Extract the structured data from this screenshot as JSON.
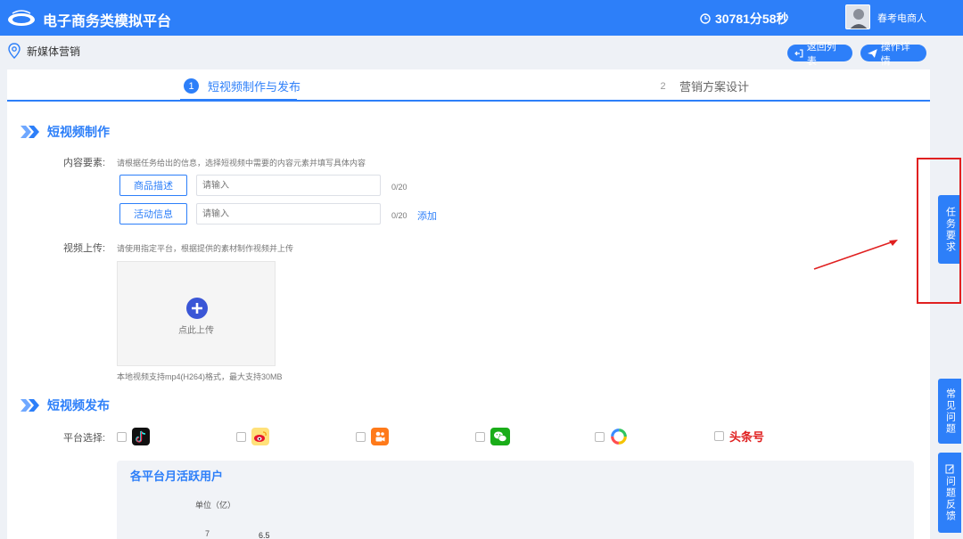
{
  "header": {
    "app_title": "电子商务类模拟平台",
    "timer": "30781分58秒",
    "username": "春考电商人"
  },
  "breadcrumb": {
    "label": "新媒体营销"
  },
  "actions": {
    "back_label": "返回列表",
    "detail_label": "操作详情"
  },
  "steps": [
    {
      "num": "1",
      "label": "短视频制作与发布",
      "active": true
    },
    {
      "num": "2",
      "label": "营销方案设计",
      "active": false
    }
  ],
  "production": {
    "title": "短视频制作",
    "content_label": "内容要素:",
    "content_hint": "请根据任务给出的信息，选择短视频中需要的内容元素并填写具体内容",
    "rows": [
      {
        "tag": "商品描述",
        "placeholder": "请输入",
        "counter": "0/20"
      },
      {
        "tag": "活动信息",
        "placeholder": "请输入",
        "counter": "0/20"
      }
    ],
    "add_label": "添加",
    "upload_label": "视频上传:",
    "upload_hint": "请使用指定平台，根据提供的素材制作视频并上传",
    "upload_button": "点此上传",
    "upload_note": "本地视频支持mp4(H264)格式，最大支持30MB"
  },
  "publish": {
    "title": "短视频发布",
    "platform_label": "平台选择:",
    "platforms": [
      {
        "icon": "douyin-icon",
        "text": ""
      },
      {
        "icon": "weibo-icon",
        "text": ""
      },
      {
        "icon": "kuaishou-icon",
        "text": ""
      },
      {
        "icon": "wechat-icon",
        "text": ""
      },
      {
        "icon": "ring-icon",
        "text": ""
      },
      {
        "icon": "toutiao-icon",
        "text": "头条号"
      }
    ]
  },
  "chart_data": {
    "type": "bar",
    "title": "各平台月活跃用户",
    "ylabel": "单位（亿）",
    "yticks": [
      "7"
    ],
    "data_labels": [
      "6.5"
    ]
  },
  "sidebar": {
    "task_label": "任务要求",
    "faq_label": "常见问题",
    "feedback_label": "问题反馈"
  },
  "colors": {
    "primary": "#2d7ff9",
    "highlight": "#e02020"
  }
}
